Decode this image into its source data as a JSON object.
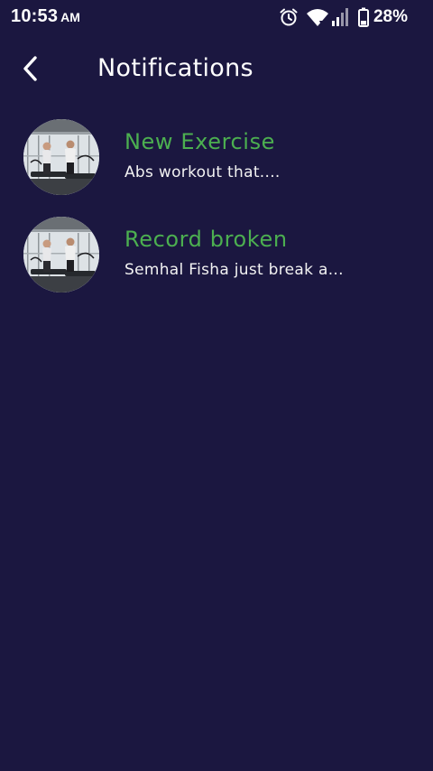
{
  "status_bar": {
    "time": "10:53",
    "ampm": "AM",
    "battery_percent": "28%",
    "icons": [
      "alarm-icon",
      "wifi-icon",
      "signal-icon",
      "battery-icon"
    ]
  },
  "header": {
    "title": "Notifications",
    "back_icon": "chevron-left-icon"
  },
  "notifications": [
    {
      "title": "New Exercise",
      "message": "Abs workout that...."
    },
    {
      "title": "Record broken",
      "message": "Semhal Fisha just break a..."
    }
  ],
  "colors": {
    "background": "#1b1740",
    "accent_green": "#4caf50",
    "text": "#ffffff"
  }
}
